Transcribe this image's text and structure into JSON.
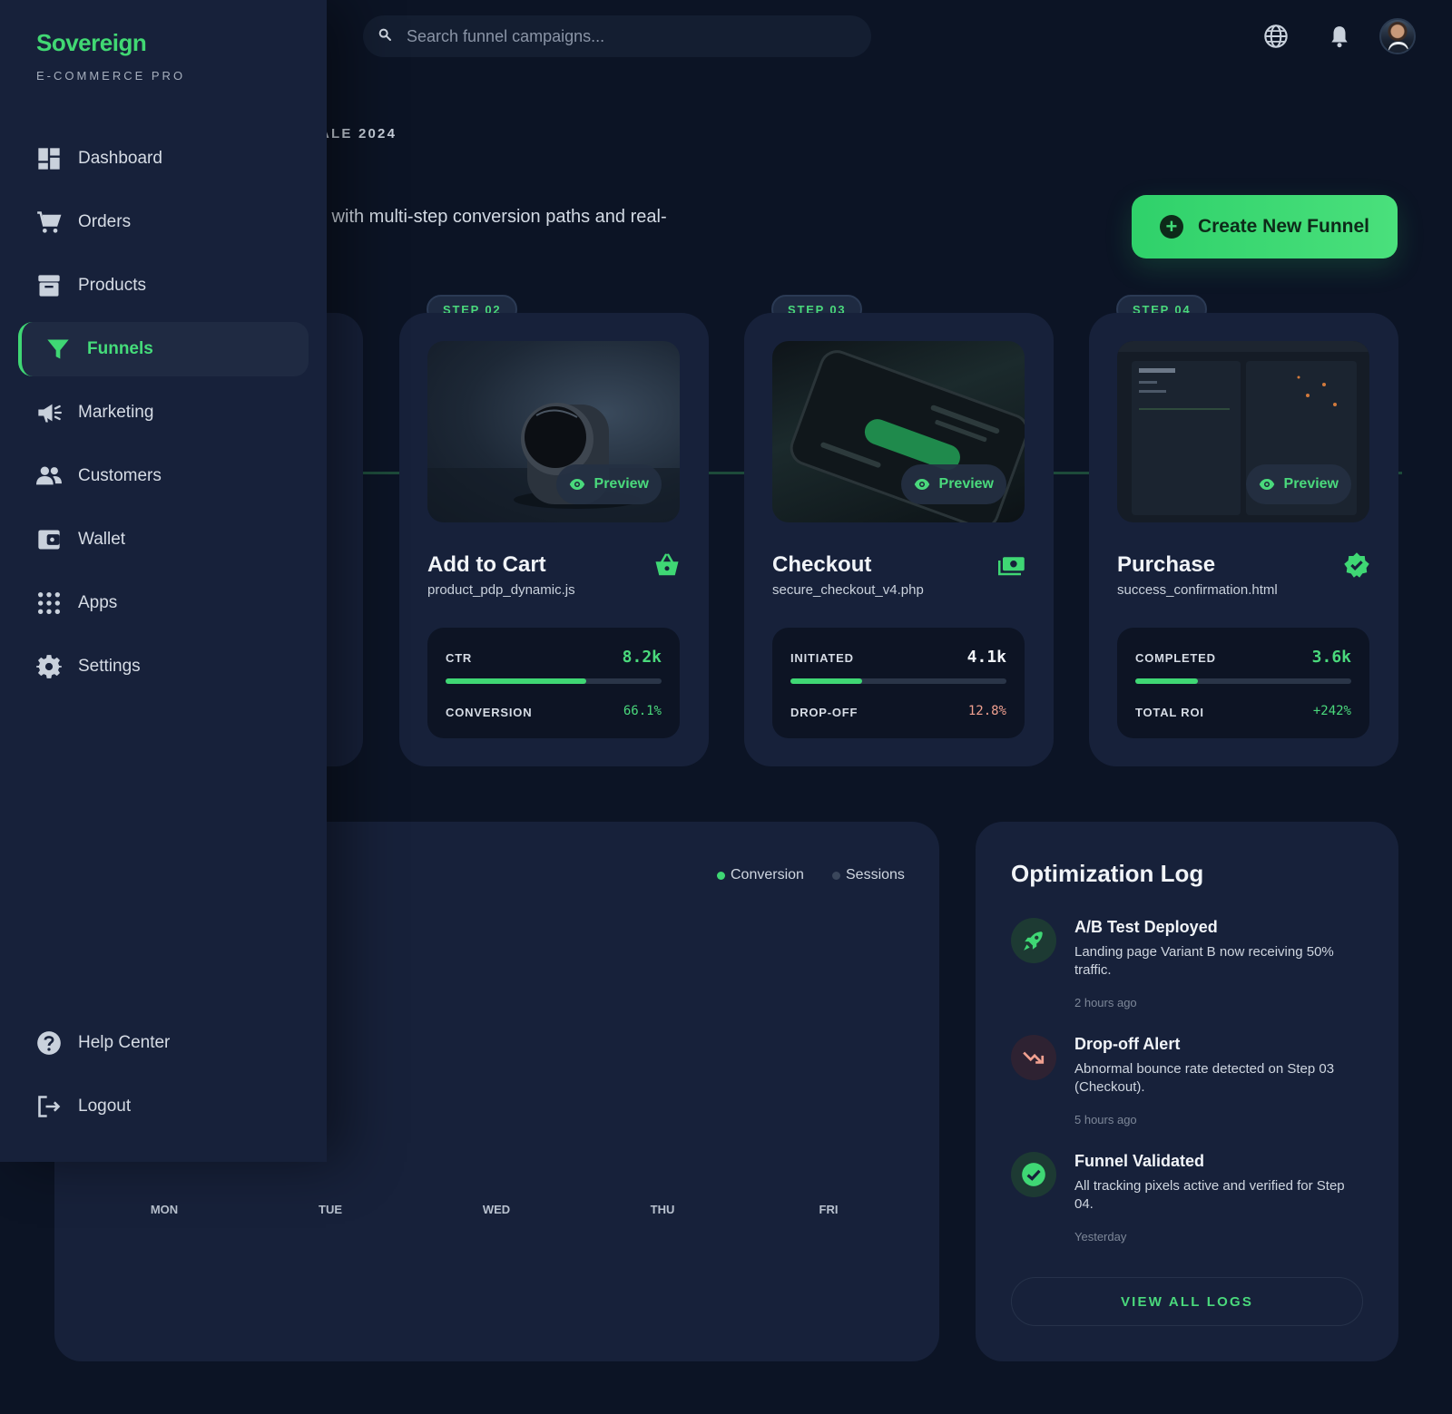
{
  "app": {
    "brand": "Sovereign",
    "brand_sub": "E-COMMERCE PRO",
    "accent": "#41d873"
  },
  "topbar": {
    "search_placeholder": "Search funnel campaigns...",
    "icons": [
      "search-icon",
      "globe-icon",
      "bell-icon",
      "avatar"
    ]
  },
  "sidebar": {
    "items": [
      {
        "label": "Dashboard",
        "icon": "dashboard-icon"
      },
      {
        "label": "Orders",
        "icon": "cart-icon"
      },
      {
        "label": "Products",
        "icon": "archive-icon"
      },
      {
        "label": "Funnels",
        "icon": "funnel-icon",
        "active": true
      },
      {
        "label": "Marketing",
        "icon": "megaphone-icon"
      },
      {
        "label": "Customers",
        "icon": "people-icon"
      },
      {
        "label": "Wallet",
        "icon": "wallet-icon"
      },
      {
        "label": "Apps",
        "icon": "apps-grid-icon"
      },
      {
        "label": "Settings",
        "icon": "gear-icon"
      }
    ],
    "footer": [
      {
        "label": "Help Center",
        "icon": "help-icon"
      },
      {
        "label": "Logout",
        "icon": "logout-icon"
      }
    ]
  },
  "header": {
    "eyebrow": "ALE 2024",
    "subtitle": "y with multi-step conversion paths and real-",
    "create_button": "Create New Funnel"
  },
  "steps": [
    {
      "badge": "STEP 02",
      "title": "Add to Cart",
      "file": "product_pdp_dynamic.js",
      "icon": "basket-icon",
      "preview": "Preview",
      "metric1": {
        "label": "CTR",
        "value": "8.2k",
        "progress": 0.65
      },
      "metric2": {
        "label": "CONVERSION",
        "value": "66.1%",
        "color": "#4ad97c"
      }
    },
    {
      "badge": "STEP 03",
      "title": "Checkout",
      "file": "secure_checkout_v4.php",
      "icon": "cash-icon",
      "preview": "Preview",
      "metric1": {
        "label": "INITIATED",
        "value": "4.1k",
        "progress": 0.33
      },
      "metric2": {
        "label": "DROP-OFF",
        "value": "12.8%",
        "color": "#f0a090"
      }
    },
    {
      "badge": "STEP 04",
      "title": "Purchase",
      "file": "success_confirmation.html",
      "icon": "verified-icon",
      "preview": "Preview",
      "metric1": {
        "label": "COMPLETED",
        "value": "3.6k",
        "progress": 0.29
      },
      "metric2": {
        "label": "TOTAL ROI",
        "value": "+242%",
        "color": "#4ad97c"
      }
    }
  ],
  "chart": {
    "legend": [
      {
        "label": "Conversion",
        "color": "#3fd774"
      },
      {
        "label": "Sessions",
        "color": "#3a465b"
      }
    ],
    "days": [
      "MON",
      "TUE",
      "WED",
      "THU",
      "FRI"
    ]
  },
  "log": {
    "title": "Optimization Log",
    "items": [
      {
        "title": "A/B Test Deployed",
        "desc": "Landing page Variant B now receiving 50% traffic.",
        "time": "2 hours ago",
        "icon": "rocket-icon"
      },
      {
        "title": "Drop-off Alert",
        "desc": "Abnormal bounce rate detected on Step 03 (Checkout).",
        "time": "5 hours ago",
        "icon": "trending-down-icon"
      },
      {
        "title": "Funnel Validated",
        "desc": "All tracking pixels active and verified for Step 04.",
        "time": "Yesterday",
        "icon": "check-circle-icon"
      }
    ],
    "view_all": "VIEW ALL LOGS"
  }
}
